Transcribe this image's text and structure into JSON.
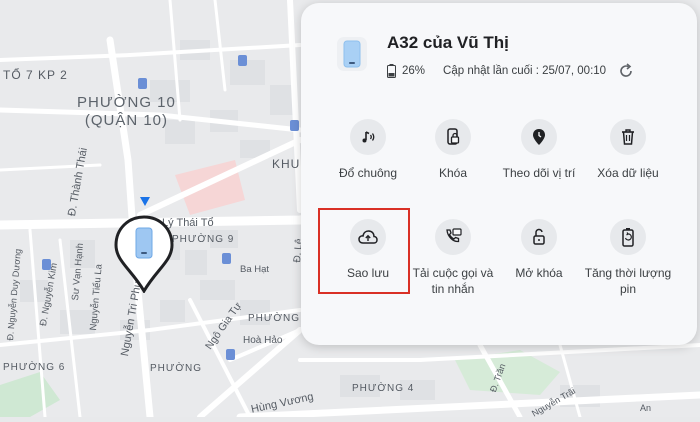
{
  "map": {
    "labels": {
      "to7kp2": "TỔ 7 KP 2",
      "phuong10": "PHƯỜNG 10",
      "quan10": "(QUẬN 10)",
      "thanhthai": "Đ. Thành Thái",
      "lythaito": "Lý Thái Tổ",
      "phuong9": "PHƯỜNG 9",
      "bahat": "Ba Hạt",
      "khu": "KHU",
      "nguyentriphuong": "Nguyễn Tri Phương",
      "suvanhanh": "Sư Vạn Hạnh",
      "nguyentieula": "Nguyễn Tiểu La",
      "dnguyenkim": "Đ. Nguyễn Kim",
      "dnguyenduytien": "Đ. Nguyễn Duy Dương",
      "phuong6": "PHƯỜNG 6",
      "phuong5": "PHƯỜNG",
      "phuongx": "PHƯỜNG",
      "ngogiatu": "Ngô Gia Tự",
      "hoahao": "Hoà Hảo",
      "hungvuong": "Hùng Vương",
      "phuong4": "PHƯỜNG 4",
      "dle": "Đ. Lê",
      "nguyentrai": "Nguyễn Trãi",
      "dtran": "Đ. Trần",
      "an": "An"
    }
  },
  "device": {
    "name": "A32 của Vũ Thị",
    "battery": "26%",
    "last_updated": "Cập nhật lần cuối : 25/07, 00:10"
  },
  "actions": [
    {
      "label": "Đổ chuông",
      "icon": "ring-icon"
    },
    {
      "label": "Khóa",
      "icon": "lock-icon"
    },
    {
      "label": "Theo dõi vị trí",
      "icon": "location-icon"
    },
    {
      "label": "Xóa dữ liệu",
      "icon": "trash-icon"
    },
    {
      "label": "Sao lưu",
      "icon": "cloud-upload-icon"
    },
    {
      "label": "Tải cuộc gọi và tin nhắn",
      "icon": "calls-messages-icon"
    },
    {
      "label": "Mở khóa",
      "icon": "unlock-icon"
    },
    {
      "label": "Tăng thời lượng pin",
      "icon": "battery-boost-icon"
    }
  ],
  "colors": {
    "highlight": "#d93025",
    "accent": "#1a73e8"
  }
}
